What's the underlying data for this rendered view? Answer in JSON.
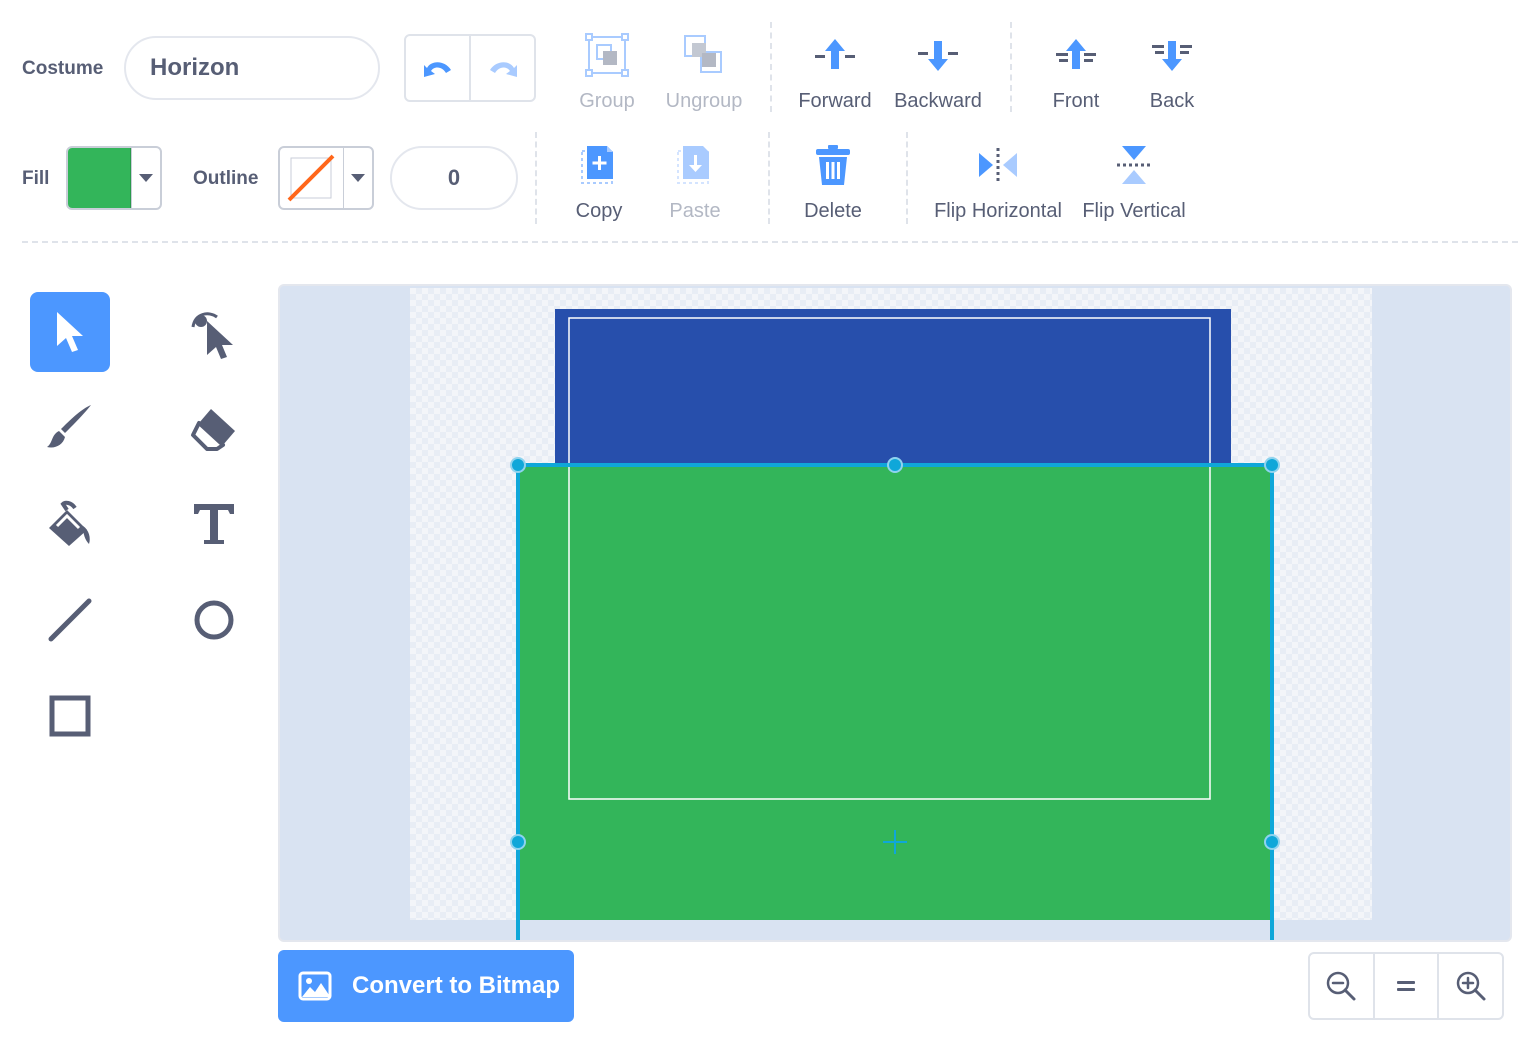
{
  "costume": {
    "label": "Costume",
    "name_value": "Horizon"
  },
  "history": {
    "undo_icon": "undo-icon",
    "redo_icon": "redo-icon"
  },
  "toolbar": {
    "group": "Group",
    "ungroup": "Ungroup",
    "forward": "Forward",
    "backward": "Backward",
    "front": "Front",
    "back": "Back",
    "copy": "Copy",
    "paste": "Paste",
    "delete": "Delete",
    "flip_horizontal": "Flip Horizontal",
    "flip_vertical": "Flip Vertical"
  },
  "style": {
    "fill_label": "Fill",
    "fill_color": "#33b55a",
    "outline_label": "Outline",
    "outline_color": "none",
    "outline_width": "0"
  },
  "tools": [
    {
      "name": "select",
      "active": true
    },
    {
      "name": "reshape",
      "active": false
    },
    {
      "name": "brush",
      "active": false
    },
    {
      "name": "eraser",
      "active": false
    },
    {
      "name": "fill",
      "active": false
    },
    {
      "name": "text",
      "active": false
    },
    {
      "name": "line",
      "active": false
    },
    {
      "name": "circle",
      "active": false
    },
    {
      "name": "rectangle",
      "active": false
    }
  ],
  "canvas": {
    "shapes": [
      {
        "name": "blue-rectangle",
        "color": "#274fac"
      },
      {
        "name": "green-rectangle",
        "color": "#33b55a",
        "selected": true
      }
    ],
    "selection_color": "#0fa7d9"
  },
  "convert": {
    "label": "Convert to Bitmap"
  },
  "zoom": {
    "out_icon": "zoom-out-icon",
    "reset_icon": "zoom-reset-icon",
    "in_icon": "zoom-in-icon"
  },
  "colors": {
    "accent": "#4c97ff",
    "text": "#575e75",
    "disabled": "#b3b8c4"
  }
}
